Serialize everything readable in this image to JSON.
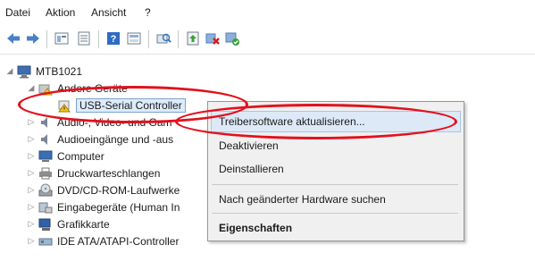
{
  "menubar": {
    "items": [
      "Datei",
      "Aktion",
      "Ansicht",
      "?"
    ]
  },
  "toolbar": {
    "buttons": [
      "back-arrow-icon",
      "forward-arrow-icon",
      "properties-view-icon",
      "list-view-icon",
      "help-icon",
      "details-view-icon",
      "scan-hardware-icon",
      "update-driver-icon",
      "uninstall-device-icon",
      "enable-device-icon"
    ]
  },
  "tree": {
    "root": "MTB1021",
    "group": "Andere Geräte",
    "selected_device": "USB-Serial Controller",
    "items": [
      "Audio-, Video- und Gam",
      "Audioeingänge und -aus",
      "Computer",
      "Druckwarteschlangen",
      "DVD/CD-ROM-Laufwerke",
      "Eingabegeräte (Human In",
      "Grafikkarte",
      "IDE ATA/ATAPI-Controller"
    ]
  },
  "context_menu": {
    "update_driver": "Treibersoftware aktualisieren...",
    "disable": "Deaktivieren",
    "uninstall": "Deinstallieren",
    "scan": "Nach geänderter Hardware suchen",
    "properties": "Eigenschaften"
  },
  "colors": {
    "annotation_ring": "#e4101c",
    "selection": "#dcecfc",
    "menu_bg": "#f0f0f0"
  }
}
